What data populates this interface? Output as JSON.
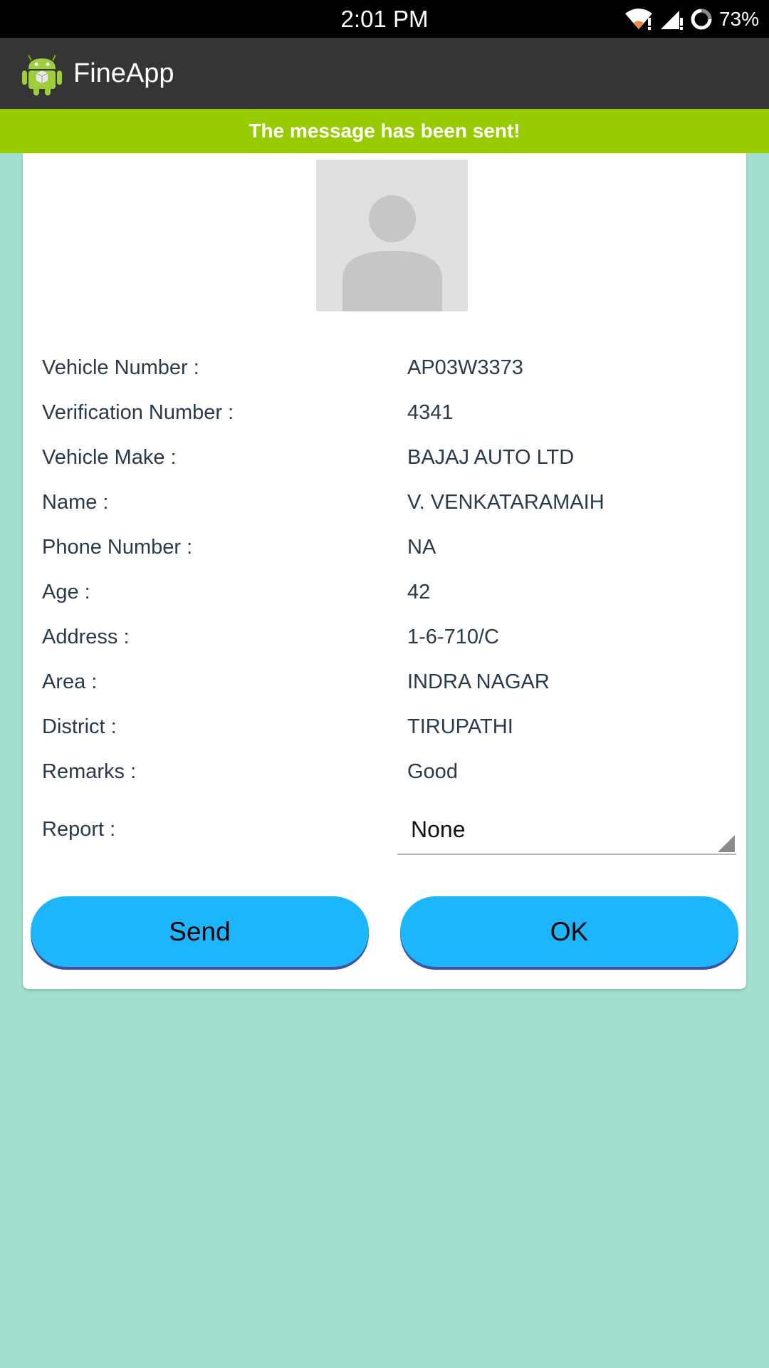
{
  "status_bar": {
    "time": "2:01 PM",
    "battery": "73%"
  },
  "app_bar": {
    "title": "FineApp"
  },
  "banner": {
    "message": "The message has been sent!"
  },
  "details": [
    {
      "label": "Vehicle Number :",
      "value": "AP03W3373"
    },
    {
      "label": "Verification Number :",
      "value": "4341"
    },
    {
      "label": "Vehicle Make :",
      "value": "BAJAJ AUTO LTD"
    },
    {
      "label": "Name :",
      "value": "V. VENKATARAMAIH"
    },
    {
      "label": "Phone Number :",
      "value": "NA"
    },
    {
      "label": "Age :",
      "value": "42"
    },
    {
      "label": "Address :",
      "value": "1-6-710/C"
    },
    {
      "label": "Area :",
      "value": "INDRA NAGAR"
    },
    {
      "label": "District :",
      "value": "TIRUPATHI"
    },
    {
      "label": "Remarks :",
      "value": "Good"
    }
  ],
  "report": {
    "label": "Report :",
    "selected": "None"
  },
  "buttons": {
    "send": "Send",
    "ok": "OK"
  },
  "colors": {
    "background": "#a3dfd1",
    "banner": "#99cc00",
    "button": "#1db5fb",
    "button_shadow": "#3e51a2",
    "app_bar": "#353535"
  }
}
